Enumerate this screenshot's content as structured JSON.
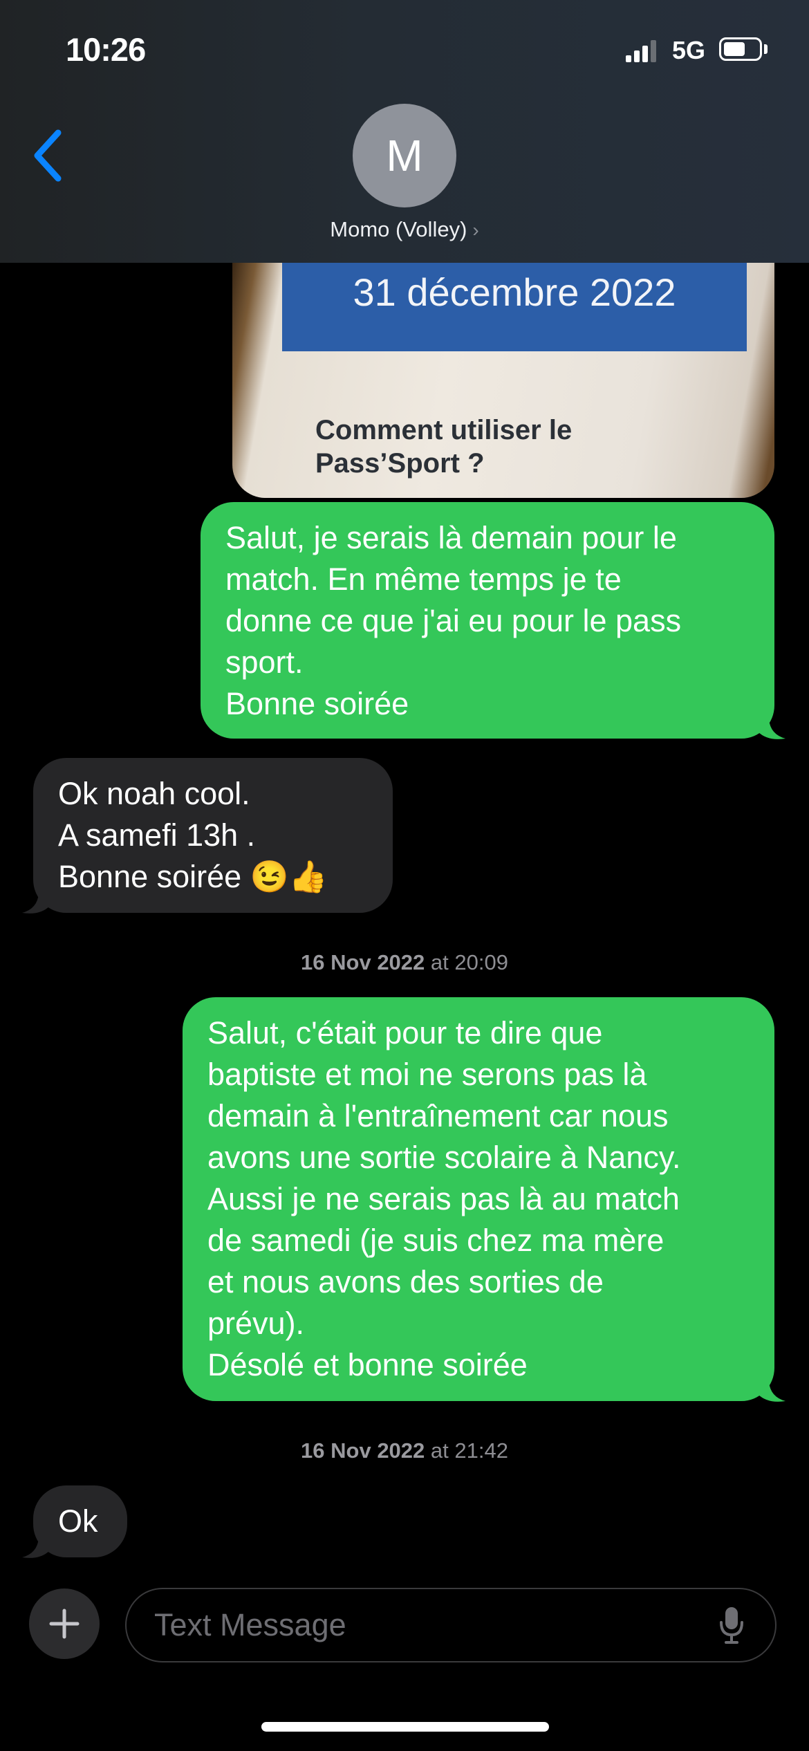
{
  "status_bar": {
    "time": "10:26",
    "network": "5G"
  },
  "header": {
    "avatar_initial": "M",
    "contact_name": "Momo (Volley)",
    "chevron": "›"
  },
  "attachment": {
    "date_text": "31 décembre 2022",
    "line1": "Comment utiliser le",
    "line2": "Pass’Sport ?"
  },
  "messages": [
    {
      "from": "me",
      "lines": [
        "Salut, je serais là demain pour le",
        "match. En même temps je te",
        "donne ce que j'ai eu pour le pass",
        "sport.",
        "Bonne soirée"
      ]
    },
    {
      "from": "them",
      "lines": [
        "Ok noah cool.",
        "A samefi 13h .",
        "Bonne soirée 😉👍"
      ]
    },
    {
      "from": "me",
      "lines": [
        "Salut, c'était pour te dire que",
        "baptiste et moi ne serons pas là",
        "demain à l'entraînement car nous",
        "avons une sortie scolaire à Nancy.",
        "Aussi je ne serais pas là au match",
        "de samedi (je suis chez ma mère",
        "et nous avons des sorties de",
        "prévu).",
        "Désolé et bonne soirée"
      ]
    },
    {
      "from": "them",
      "lines": [
        "Ok"
      ]
    }
  ],
  "timestamps": [
    {
      "date": "16 Nov 2022",
      "time": "at 20:09"
    },
    {
      "date": "16 Nov 2022",
      "time": "at 21:42"
    }
  ],
  "composer": {
    "placeholder": "Text Message"
  },
  "icons": [
    "back-chevron-icon",
    "plus-icon",
    "microphone-icon",
    "signal-icon",
    "battery-icon"
  ],
  "colors": {
    "sent_bubble": "#34c759",
    "received_bubble": "#262628",
    "accent": "#0a84ff"
  }
}
